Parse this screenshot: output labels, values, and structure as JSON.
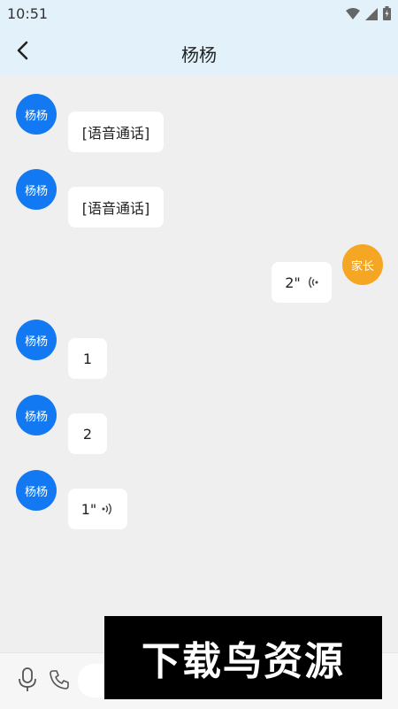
{
  "status_bar": {
    "time": "10:51"
  },
  "header": {
    "title": "杨杨"
  },
  "avatars": {
    "child": "杨杨",
    "parent": "家长"
  },
  "messages": [
    {
      "sender": "杨杨",
      "text": "[语音通话]"
    },
    {
      "sender": "杨杨",
      "text": "[语音通话]"
    },
    {
      "sender": "家长",
      "voice_duration": "2\""
    },
    {
      "sender": "杨杨",
      "text": "1"
    },
    {
      "sender": "杨杨",
      "text": "2"
    },
    {
      "sender": "杨杨",
      "voice_duration": "1\""
    }
  ],
  "watermark": {
    "text": "下载鸟资源"
  }
}
